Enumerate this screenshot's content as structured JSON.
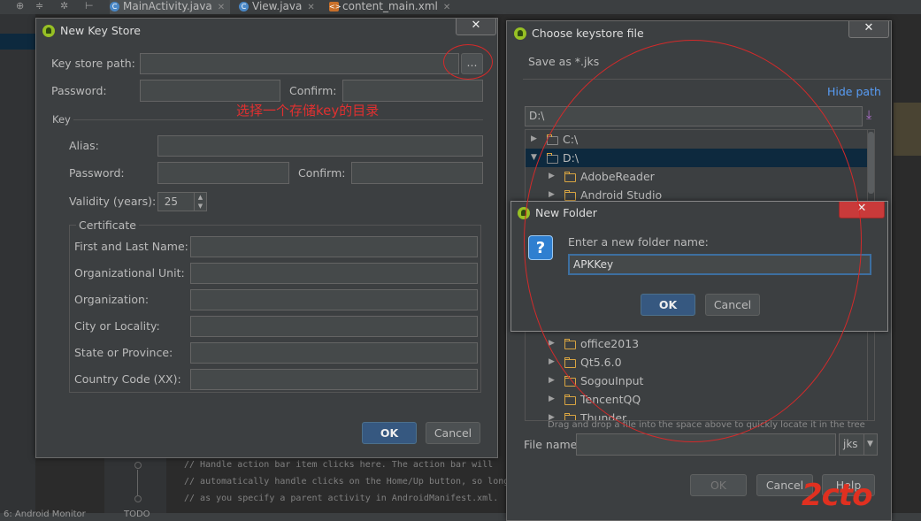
{
  "ide": {
    "tabs": [
      {
        "label": "MainActivity.java"
      },
      {
        "label": "View.java"
      },
      {
        "label": "content_main.xml"
      }
    ],
    "code_lines": [
      "// Handle action bar item clicks here. The action bar will",
      "// automatically handle clicks on the Home/Up button, so long",
      "// as you specify a parent activity in AndroidManifest.xml."
    ],
    "bottom_left": "6: Android Monitor",
    "bottom_todo": "TODO"
  },
  "key_store_dialog": {
    "title": "New Key Store",
    "key_store_path_label": "Key store path:",
    "browse_label": "...",
    "password_label": "Password:",
    "confirm_label": "Confirm:",
    "annotation": "选择一个存储key的目录",
    "key_section": "Key",
    "alias_label": "Alias:",
    "key_password_label": "Password:",
    "key_confirm_label": "Confirm:",
    "validity_label": "Validity (years):",
    "validity_value": "25",
    "certificate_section": "Certificate",
    "cert_fields": [
      {
        "label": "First and Last Name:"
      },
      {
        "label": "Organizational Unit:"
      },
      {
        "label": "Organization:"
      },
      {
        "label": "City or Locality:"
      },
      {
        "label": "State or Province:"
      },
      {
        "label": "Country Code (XX):"
      }
    ],
    "ok_label": "OK",
    "cancel_label": "Cancel"
  },
  "keystore_file_dialog": {
    "title": "Choose keystore file",
    "subtitle": "Save as *.jks",
    "hide_path_label": "Hide path",
    "path_value": "D:\\",
    "tree": [
      {
        "label": "C:\\",
        "expanded": false,
        "level": 0
      },
      {
        "label": "D:\\",
        "expanded": true,
        "level": 0,
        "selected": true
      },
      {
        "label": "AdobeReader",
        "level": 1
      },
      {
        "label": "Android Studio",
        "level": 1
      },
      {
        "label": "office2013",
        "level": 1
      },
      {
        "label": "Qt5.6.0",
        "level": 1
      },
      {
        "label": "SogouInput",
        "level": 1
      },
      {
        "label": "TencentQQ",
        "level": 1
      },
      {
        "label": "Thunder",
        "level": 1
      }
    ],
    "hint": "Drag and drop a file into the space above to quickly locate it in the tree",
    "file_name_label": "File name:",
    "file_name_value": "",
    "extension": "jks",
    "ok_label": "OK",
    "cancel_label": "Cancel",
    "help_label": "Help"
  },
  "new_folder_dialog": {
    "title": "New Folder",
    "prompt": "Enter a new folder name:",
    "value": "APKKey",
    "ok_label": "OK",
    "cancel_label": "Cancel"
  },
  "watermark": "2cto",
  "colors": {
    "accent_blue": "#589df6",
    "annotation_red": "#e03030",
    "selection": "#0d293e",
    "android_green": "#97c024"
  }
}
